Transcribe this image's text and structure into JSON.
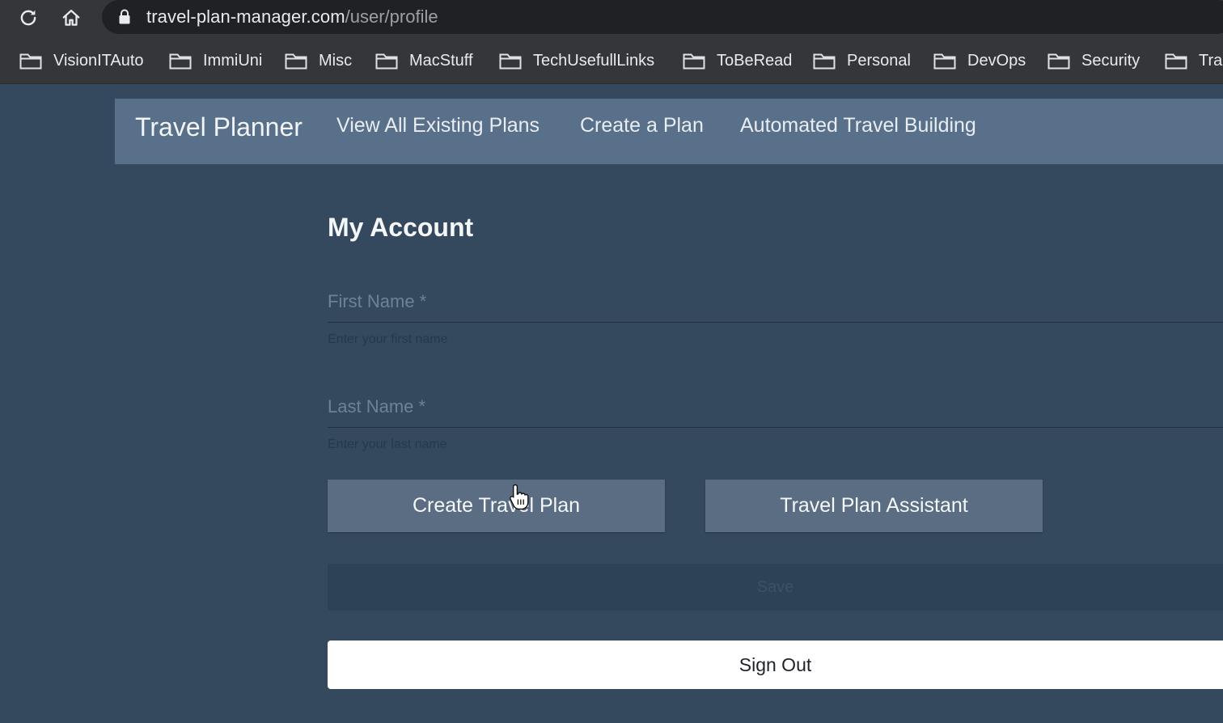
{
  "browser": {
    "url_host": "travel-plan-manager.com",
    "url_path": "/user/profile",
    "icons": {
      "reload": "reload-icon",
      "home": "home-icon",
      "lock": "lock-icon",
      "folder": "folder-icon"
    },
    "bookmarks": [
      {
        "label": "VisionITAuto"
      },
      {
        "label": "ImmiUni"
      },
      {
        "label": "Misc"
      },
      {
        "label": "MacStuff"
      },
      {
        "label": "TechUsefullLinks"
      },
      {
        "label": "ToBeRead"
      },
      {
        "label": "Personal"
      },
      {
        "label": "DevOps"
      },
      {
        "label": "Security"
      },
      {
        "label": "Tra"
      }
    ]
  },
  "navbar": {
    "brand": "Travel Planner",
    "links": {
      "view_all": "View All Existing Plans",
      "create": "Create a Plan",
      "automated": "Automated Travel Building"
    }
  },
  "account": {
    "title": "My Account",
    "first_name": {
      "label": "First Name *",
      "value": "",
      "helper": "Enter your first name"
    },
    "last_name": {
      "label": "Last Name *",
      "value": "",
      "helper": "Enter your last name"
    },
    "buttons": {
      "create_travel_plan": "Create Travel Plan",
      "travel_plan_assistant": "Travel Plan Assistant",
      "save": "Save",
      "sign_out": "Sign Out"
    }
  },
  "colors": {
    "page_bg": "#34495e",
    "navbar_bg": "#587089",
    "button_bg": "#5a6d82",
    "signout_bg": "#ffffff"
  }
}
